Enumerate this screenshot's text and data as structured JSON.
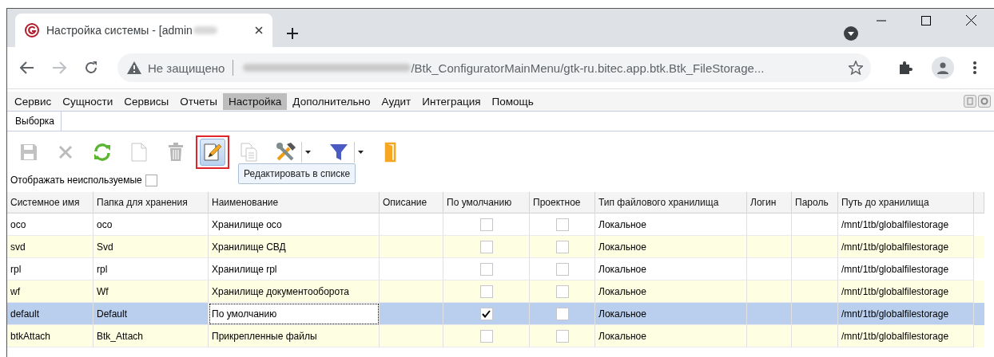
{
  "browser": {
    "tab_title": "Настройка системы - [admin",
    "security": "Не защищено",
    "url": "/Btk_ConfiguratorMainMenu/gtk-ru.bitec.app.btk.Btk_FileStorage..."
  },
  "menu": [
    {
      "label": "Сервис",
      "selected": false
    },
    {
      "label": "Сущности",
      "selected": false
    },
    {
      "label": "Сервисы",
      "selected": false
    },
    {
      "label": "Отчеты",
      "selected": false
    },
    {
      "label": "Настройка",
      "selected": true
    },
    {
      "label": "Дополнительно",
      "selected": false
    },
    {
      "label": "Аудит",
      "selected": false
    },
    {
      "label": "Интеграция",
      "selected": false
    },
    {
      "label": "Помощь",
      "selected": false
    }
  ],
  "filter": {
    "label": "Выборка"
  },
  "toolbar": [
    {
      "kind": "save",
      "disabled": true,
      "highlighted": false,
      "dropdown": false
    },
    {
      "kind": "cancel",
      "disabled": true,
      "highlighted": false,
      "dropdown": false
    },
    {
      "kind": "refresh",
      "disabled": false,
      "highlighted": false,
      "dropdown": false
    },
    {
      "kind": "new",
      "disabled": true,
      "highlighted": false,
      "dropdown": false
    },
    {
      "kind": "delete",
      "disabled": true,
      "highlighted": false,
      "dropdown": false
    },
    {
      "kind": "edit",
      "disabled": false,
      "highlighted": true,
      "dropdown": false
    },
    {
      "kind": "copy",
      "disabled": true,
      "highlighted": false,
      "dropdown": false
    },
    {
      "kind": "tools",
      "disabled": false,
      "highlighted": false,
      "dropdown": true
    },
    {
      "kind": "filter",
      "disabled": false,
      "highlighted": false,
      "dropdown": true
    },
    {
      "kind": "exit",
      "disabled": false,
      "highlighted": false,
      "dropdown": false
    }
  ],
  "tooltip": "Редактировать в списке",
  "show_unused": {
    "label": "Отображать неиспользуемые",
    "checked": false
  },
  "table": {
    "columns": [
      "Системное имя",
      "Папка для хранения",
      "Наименование",
      "Описание",
      "По умолчанию",
      "Проектное",
      "Тип файлового хранилища",
      "Логин",
      "Пароль",
      "Путь до хранилища"
    ],
    "rows": [
      {
        "system_name": "oco",
        "folder": "oco",
        "name": "Хранилище осо",
        "default": false,
        "project": false,
        "storage_type": "Локальное",
        "path": "/mnt/1tb/globalfilestorage",
        "selected": false,
        "editing": false
      },
      {
        "system_name": "svd",
        "folder": "Svd",
        "name": "Хранилище СВД",
        "default": false,
        "project": false,
        "storage_type": "Локальное",
        "path": "/mnt/1tb/globalfilestorage",
        "selected": false,
        "editing": false
      },
      {
        "system_name": "rpl",
        "folder": "rpl",
        "name": "Хранилище rpl",
        "default": false,
        "project": false,
        "storage_type": "Локальное",
        "path": "/mnt/1tb/globalfilestorage",
        "selected": false,
        "editing": false
      },
      {
        "system_name": "wf",
        "folder": "Wf",
        "name": "Хранилище документооборота",
        "default": false,
        "project": false,
        "storage_type": "Локальное",
        "path": "/mnt/1tb/globalfilestorage",
        "selected": false,
        "editing": false
      },
      {
        "system_name": "default",
        "folder": "Default",
        "name": "По умолчанию",
        "default": true,
        "project": false,
        "storage_type": "Локальное",
        "path": "/mnt/1tb/globalfilestorage",
        "selected": true,
        "editing": true
      },
      {
        "system_name": "btkAttach",
        "folder": "Btk_Attach",
        "name": "Прикрепленные файлы",
        "default": false,
        "project": false,
        "storage_type": "Локальное",
        "path": "/mnt/1tb/globalfilestorage",
        "selected": false,
        "editing": false
      }
    ]
  }
}
